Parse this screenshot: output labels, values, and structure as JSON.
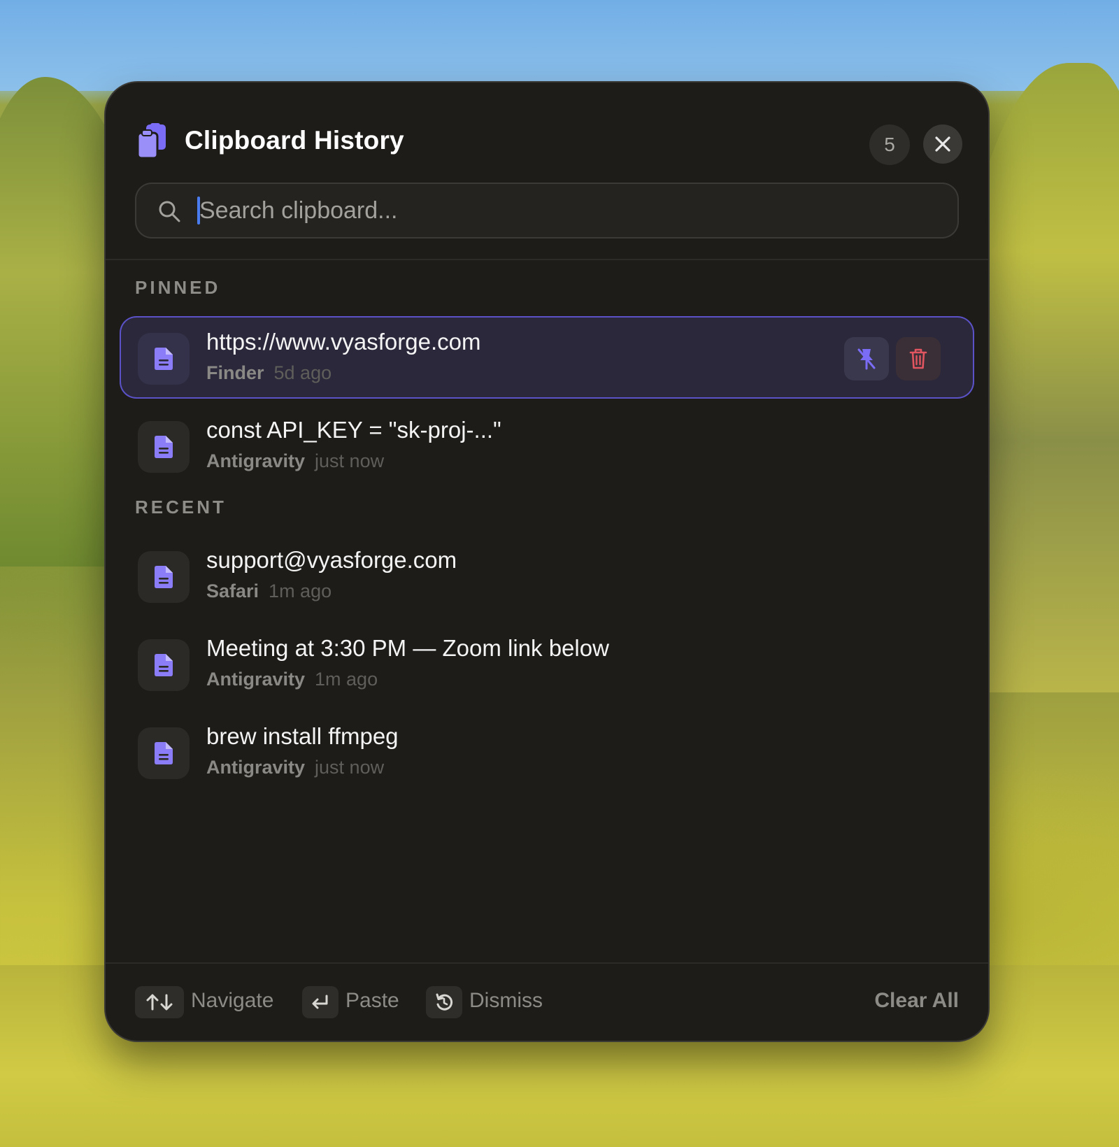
{
  "window": {
    "title": "Clipboard History",
    "count": "5"
  },
  "search": {
    "placeholder": "Search clipboard..."
  },
  "sections": {
    "pinned_label": "PINNED",
    "recent_label": "RECENT"
  },
  "pinned": [
    {
      "text": "https://www.vyasforge.com",
      "source": "Finder",
      "time": "5d ago",
      "selected": true
    },
    {
      "text": "const API_KEY = \"sk-proj-...\"",
      "source": "Antigravity",
      "time": "just now"
    }
  ],
  "recent": [
    {
      "text": "support@vyasforge.com",
      "source": "Safari",
      "time": "1m ago"
    },
    {
      "text": "Meeting at 3:30 PM — Zoom link below",
      "source": "Antigravity",
      "time": "1m ago"
    },
    {
      "text": "brew install ffmpeg",
      "source": "Antigravity",
      "time": "just now"
    }
  ],
  "footer": {
    "navigate_label": "Navigate",
    "paste_label": "Paste",
    "dismiss_label": "Dismiss",
    "clear_all_label": "Clear All"
  },
  "icons": {
    "app": "clipboard-copy-icon",
    "search": "search-icon",
    "close": "close-icon",
    "item": "document-icon",
    "unpin": "pin-off-icon",
    "delete": "trash-icon",
    "navigate": "arrows-up-down-icon",
    "paste": "return-key-icon",
    "dismiss": "undo-icon"
  },
  "colors": {
    "accent": "#7b6cf6",
    "selected_border": "#5b52c8",
    "delete": "#e0555f",
    "panel_bg": "#1d1c18"
  }
}
